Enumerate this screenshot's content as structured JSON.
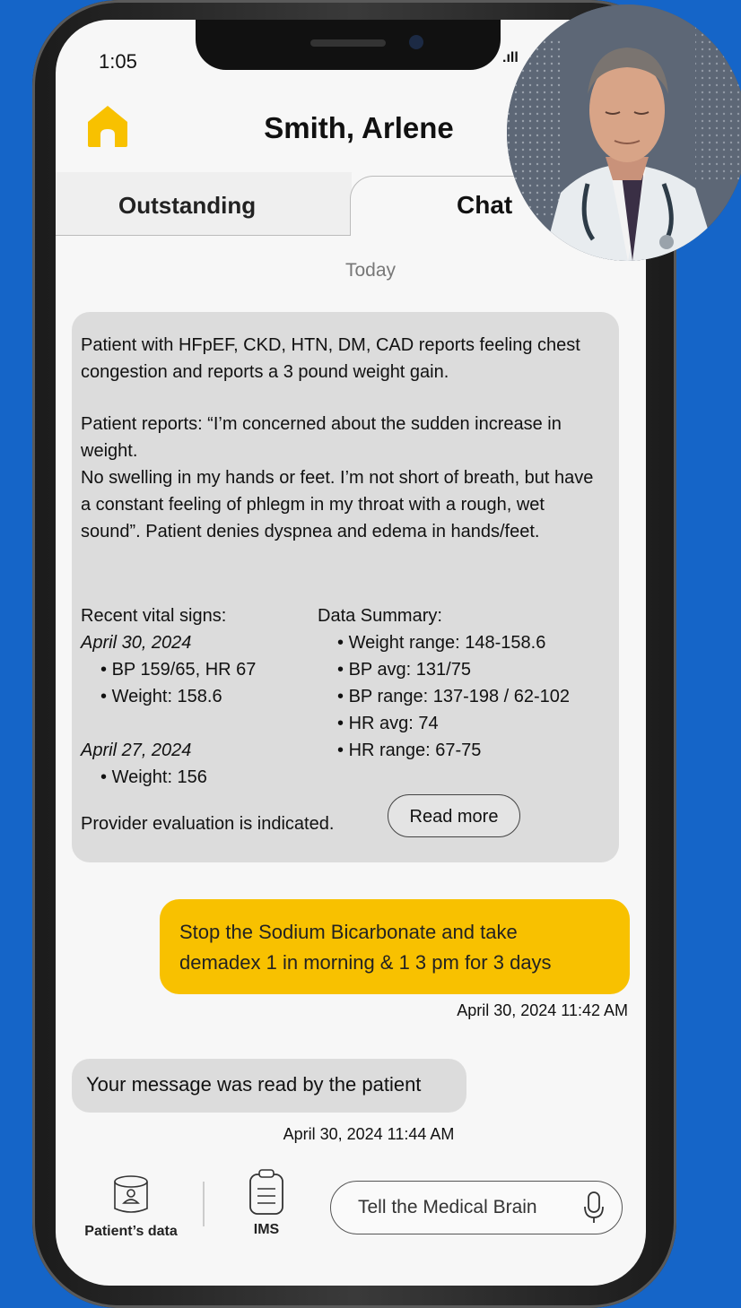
{
  "status_bar": {
    "time": "1:05",
    "signal": ".ıll"
  },
  "header": {
    "patient_name": "Smith, Arlene",
    "home_icon": "home-icon"
  },
  "tabs": [
    {
      "label": "Outstanding",
      "active": false
    },
    {
      "label": "Chat",
      "active": true
    }
  ],
  "chat": {
    "day_label": "Today",
    "summary": {
      "paragraph1": "Patient with HFpEF, CKD, HTN, DM, CAD reports feeling chest congestion and reports a 3 pound weight gain.",
      "paragraph2_line1": "Patient reports: “I’m concerned about the sudden increase in weight.",
      "paragraph2_line2": "No swelling in my hands or feet. I’m not short of breath, but have a constant feeling of phlegm in my throat with a rough, wet sound”. Patient denies dyspnea and edema in hands/feet.",
      "vitals_heading": "Recent vital signs:",
      "vitals": [
        {
          "date": "April 30, 2024",
          "items": [
            "BP 159/65, HR 67",
            "Weight: 158.6"
          ]
        },
        {
          "date": "April 27, 2024",
          "items": [
            "Weight: 156"
          ]
        }
      ],
      "data_summary_heading": "Data Summary:",
      "data_summary": [
        "Weight range: 148-158.6",
        "BP avg: 131/75",
        "BP range: 137-198 / 62-102",
        "HR avg: 74",
        "HR range: 67-75"
      ],
      "provider_note": "Provider evaluation is indicated.",
      "read_more_label": "Read more"
    },
    "order_message": {
      "text": "Stop the Sodium Bicarbonate and take demadex 1 in morning & 1 3 pm for 3 days",
      "timestamp": "April 30, 2024 11:42 AM"
    },
    "read_receipt": {
      "text": "Your message was read by the patient",
      "timestamp": "April 30, 2024 11:44 AM"
    }
  },
  "bottom_bar": {
    "patient_data_label": "Patient’s data",
    "ims_label": "IMS",
    "input_placeholder": "Tell the Medical Brain"
  },
  "colors": {
    "background": "#1565c8",
    "accent": "#f8c100",
    "bubble": "#dcdcdc"
  }
}
